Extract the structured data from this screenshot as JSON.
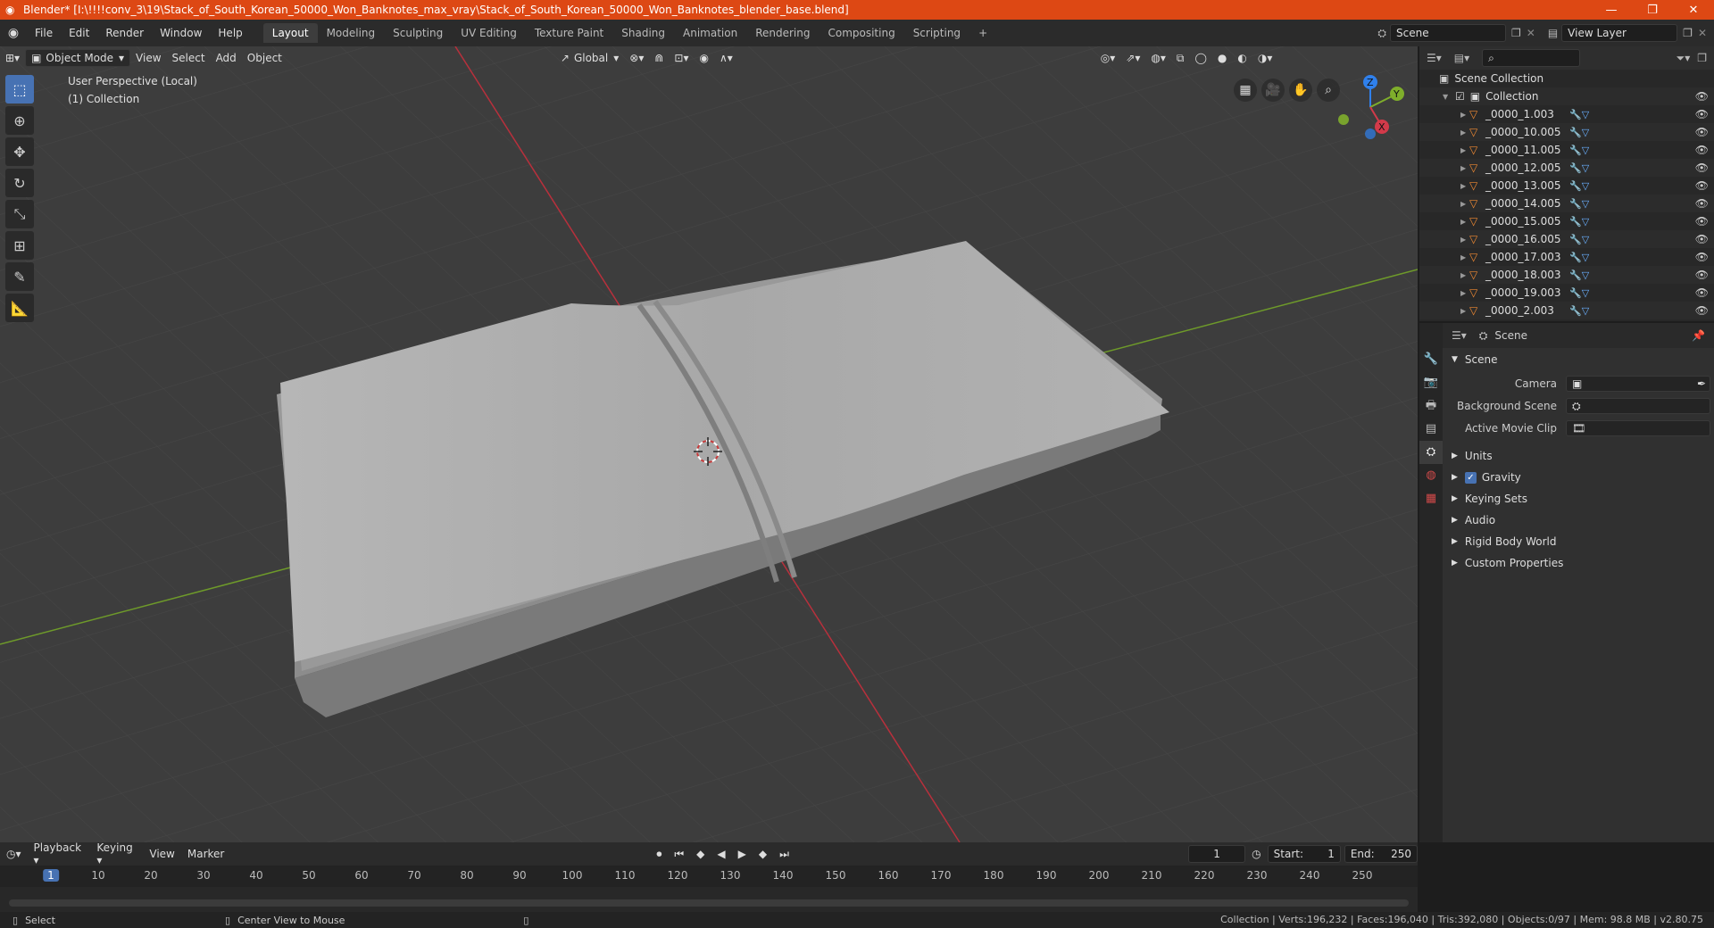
{
  "window": {
    "title": "Blender* [I:\\!!!!conv_3\\19\\Stack_of_South_Korean_50000_Won_Banknotes_max_vray\\Stack_of_South_Korean_50000_Won_Banknotes_blender_base.blend]"
  },
  "menus": [
    "File",
    "Edit",
    "Render",
    "Window",
    "Help"
  ],
  "workspaces": [
    "Layout",
    "Modeling",
    "Sculpting",
    "UV Editing",
    "Texture Paint",
    "Shading",
    "Animation",
    "Rendering",
    "Compositing",
    "Scripting"
  ],
  "active_workspace": "Layout",
  "topbar": {
    "scene": "Scene",
    "view_layer": "View Layer"
  },
  "viewport_header": {
    "mode": "Object Mode",
    "menus": [
      "View",
      "Select",
      "Add",
      "Object"
    ],
    "transform_orientation": "Global"
  },
  "viewport": {
    "perspective_label": "User Perspective (Local)",
    "collection_label": "(1) Collection",
    "gizmo_axes": {
      "x": "X",
      "y": "Y",
      "z": "Z"
    }
  },
  "outliner": {
    "root": "Scene Collection",
    "collection": "Collection",
    "items": [
      "_0000_1.003",
      "_0000_10.005",
      "_0000_11.005",
      "_0000_12.005",
      "_0000_13.005",
      "_0000_14.005",
      "_0000_15.005",
      "_0000_16.005",
      "_0000_17.003",
      "_0000_18.003",
      "_0000_19.003",
      "_0000_2.003"
    ]
  },
  "properties": {
    "header": "Scene",
    "panel": "Scene",
    "fields": {
      "camera": "Camera",
      "background_scene": "Background Scene",
      "active_movie_clip": "Active Movie Clip"
    },
    "subpanels": {
      "units": "Units",
      "gravity": "Gravity",
      "keying_sets": "Keying Sets",
      "audio": "Audio",
      "rigid_body_world": "Rigid Body World",
      "custom_properties": "Custom Properties"
    },
    "gravity_checked": true
  },
  "timeline": {
    "menus": [
      "Playback",
      "Keying",
      "View",
      "Marker"
    ],
    "current_frame": "1",
    "start_label": "Start:",
    "start": "1",
    "end_label": "End:",
    "end": "250",
    "ruler": [
      "1",
      "10",
      "20",
      "30",
      "40",
      "50",
      "60",
      "70",
      "80",
      "90",
      "100",
      "110",
      "120",
      "130",
      "140",
      "150",
      "160",
      "170",
      "180",
      "190",
      "200",
      "210",
      "220",
      "230",
      "240",
      "250"
    ]
  },
  "statusbar": {
    "select": "Select",
    "center_view": "Center View to Mouse",
    "stats": "Collection | Verts:196,232 | Faces:196,040 | Tris:392,080 | Objects:0/97 | Mem: 98.8 MB | v2.80.75"
  },
  "colors": {
    "titlebar": "#dd4814",
    "accent": "#4772b3",
    "x_axis": "#d23a4a",
    "y_axis": "#7fae2b",
    "z_axis": "#2f80ec"
  }
}
